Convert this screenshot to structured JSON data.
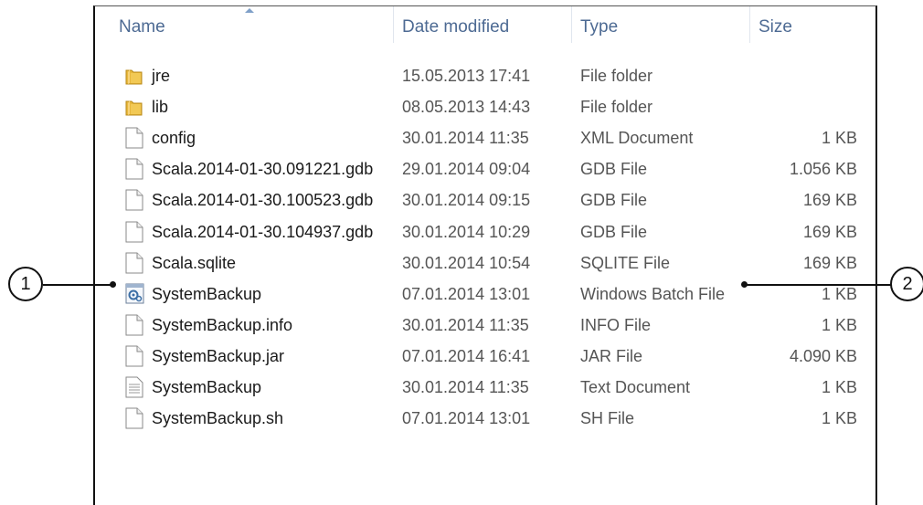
{
  "columns": {
    "name": "Name",
    "date": "Date modified",
    "type": "Type",
    "size": "Size"
  },
  "files": [
    {
      "name": "jre",
      "date": "15.05.2013 17:41",
      "type": "File folder",
      "size": "",
      "icon": "folder-icon"
    },
    {
      "name": "lib",
      "date": "08.05.2013 14:43",
      "type": "File folder",
      "size": "",
      "icon": "folder-icon"
    },
    {
      "name": "config",
      "date": "30.01.2014 11:35",
      "type": "XML Document",
      "size": "1 KB",
      "icon": "file-icon"
    },
    {
      "name": "Scala.2014-01-30.091221.gdb",
      "date": "29.01.2014 09:04",
      "type": "GDB File",
      "size": "1.056 KB",
      "icon": "file-icon"
    },
    {
      "name": "Scala.2014-01-30.100523.gdb",
      "date": "30.01.2014 09:15",
      "type": "GDB File",
      "size": "169 KB",
      "icon": "file-icon"
    },
    {
      "name": "Scala.2014-01-30.104937.gdb",
      "date": "30.01.2014 10:29",
      "type": "GDB File",
      "size": "169 KB",
      "icon": "file-icon"
    },
    {
      "name": "Scala.sqlite",
      "date": "30.01.2014 10:54",
      "type": "SQLITE File",
      "size": "169 KB",
      "icon": "file-icon"
    },
    {
      "name": "SystemBackup",
      "date": "07.01.2014 13:01",
      "type": "Windows Batch File",
      "size": "1 KB",
      "icon": "batch-file-gear-icon"
    },
    {
      "name": "SystemBackup.info",
      "date": "30.01.2014 11:35",
      "type": "INFO File",
      "size": "1 KB",
      "icon": "file-icon"
    },
    {
      "name": "SystemBackup.jar",
      "date": "07.01.2014 16:41",
      "type": "JAR File",
      "size": "4.090 KB",
      "icon": "file-icon"
    },
    {
      "name": "SystemBackup",
      "date": "30.01.2014 11:35",
      "type": "Text Document",
      "size": "1 KB",
      "icon": "text-document-icon"
    },
    {
      "name": "SystemBackup.sh",
      "date": "07.01.2014 13:01",
      "type": "SH File",
      "size": "1 KB",
      "icon": "file-icon"
    }
  ],
  "callouts": {
    "one": "1",
    "two": "2"
  },
  "colors": {
    "header_text": "#4d6a93",
    "folder": "#e8b83c"
  }
}
